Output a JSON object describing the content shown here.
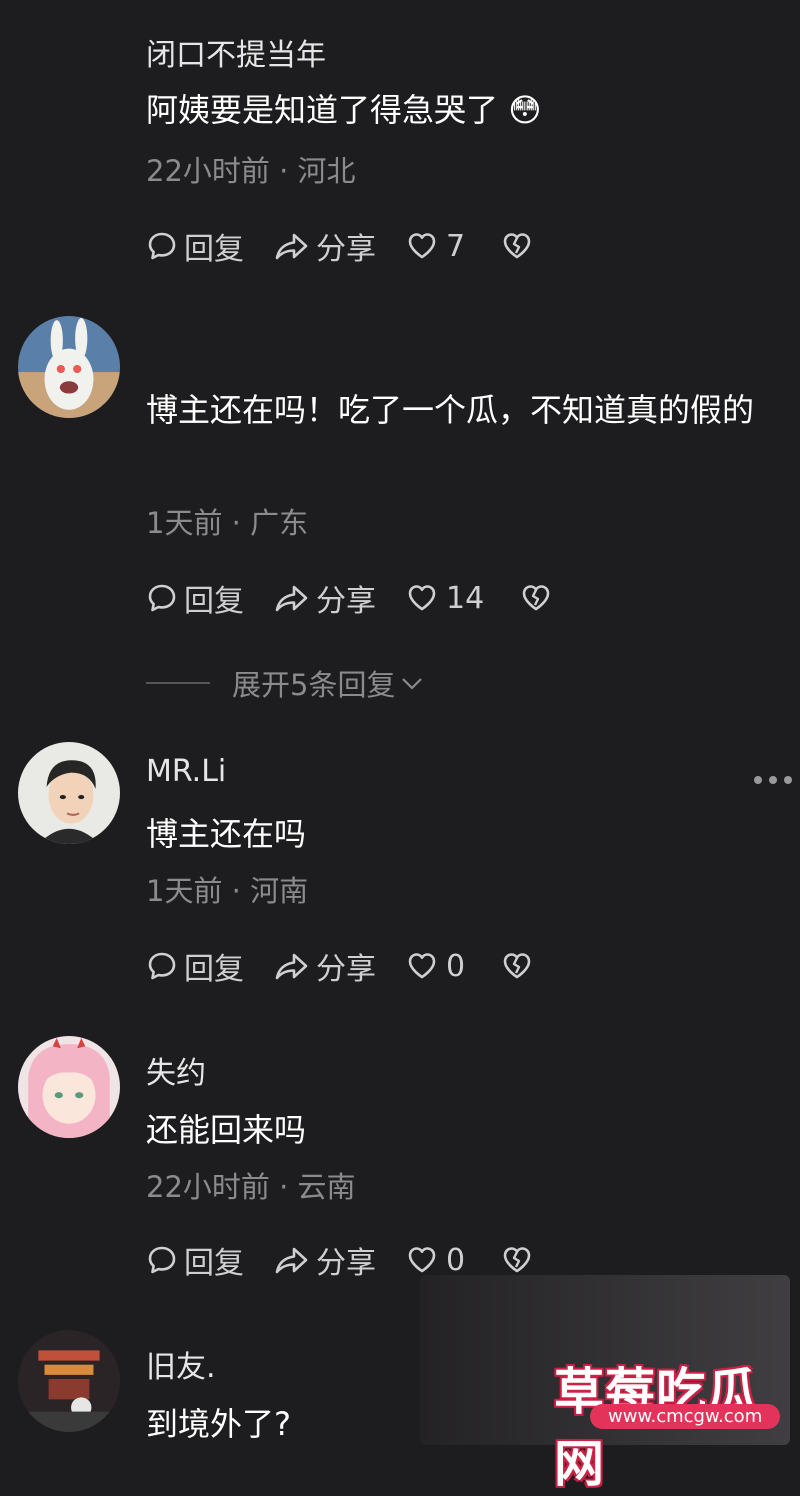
{
  "comments": [
    {
      "username": "闭口不提当年",
      "text": "阿姨要是知道了得急哭了",
      "emoji": "😳",
      "meta": "22小时前 · 河北",
      "actions": {
        "reply": "回复",
        "share": "分享",
        "likes": "7"
      }
    },
    {
      "username": "",
      "text": "博主还在吗！吃了一个瓜，不知道真的假的",
      "meta": "1天前 · 广东",
      "actions": {
        "reply": "回复",
        "share": "分享",
        "likes": "14"
      },
      "expand": "展开5条回复"
    },
    {
      "username": "MR.Li",
      "text": "博主还在吗",
      "meta": "1天前 · 河南",
      "actions": {
        "reply": "回复",
        "share": "分享",
        "likes": "0"
      }
    },
    {
      "username": "失约",
      "text": "还能回来吗",
      "meta": "22小时前 · 云南",
      "actions": {
        "reply": "回复",
        "share": "分享",
        "likes": "0"
      }
    },
    {
      "username": "旧友.",
      "text": "到境外了?",
      "meta": "",
      "actions": {}
    }
  ],
  "watermark": {
    "title": "草莓吃瓜网",
    "url": "www.cmcgw.com"
  },
  "colors": {
    "background": "#1d1c1e",
    "meta": "#8a8a8f",
    "accent": "#e4335b"
  },
  "icons": [
    "comment-icon",
    "share-icon",
    "heart-icon",
    "broken-heart-icon",
    "more-icon",
    "chevron-down-icon"
  ]
}
